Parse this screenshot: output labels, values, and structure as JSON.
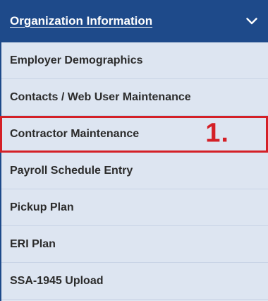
{
  "menu": {
    "header": {
      "title": "Organization Information",
      "toggle_icon": "chevron-down-icon"
    },
    "items": [
      {
        "label": "Employer Demographics"
      },
      {
        "label": "Contacts / Web User Maintenance"
      },
      {
        "label": "Contractor Maintenance"
      },
      {
        "label": "Payroll Schedule Entry"
      },
      {
        "label": "Pickup Plan"
      },
      {
        "label": "ERI Plan"
      },
      {
        "label": "SSA-1945 Upload"
      }
    ]
  },
  "annotation": {
    "step_label": "1.",
    "highlight_color": "#d42027"
  },
  "colors": {
    "header_bg": "#1e4a8a",
    "menu_bg": "#dde5f1",
    "item_text": "#2b2b2b"
  }
}
